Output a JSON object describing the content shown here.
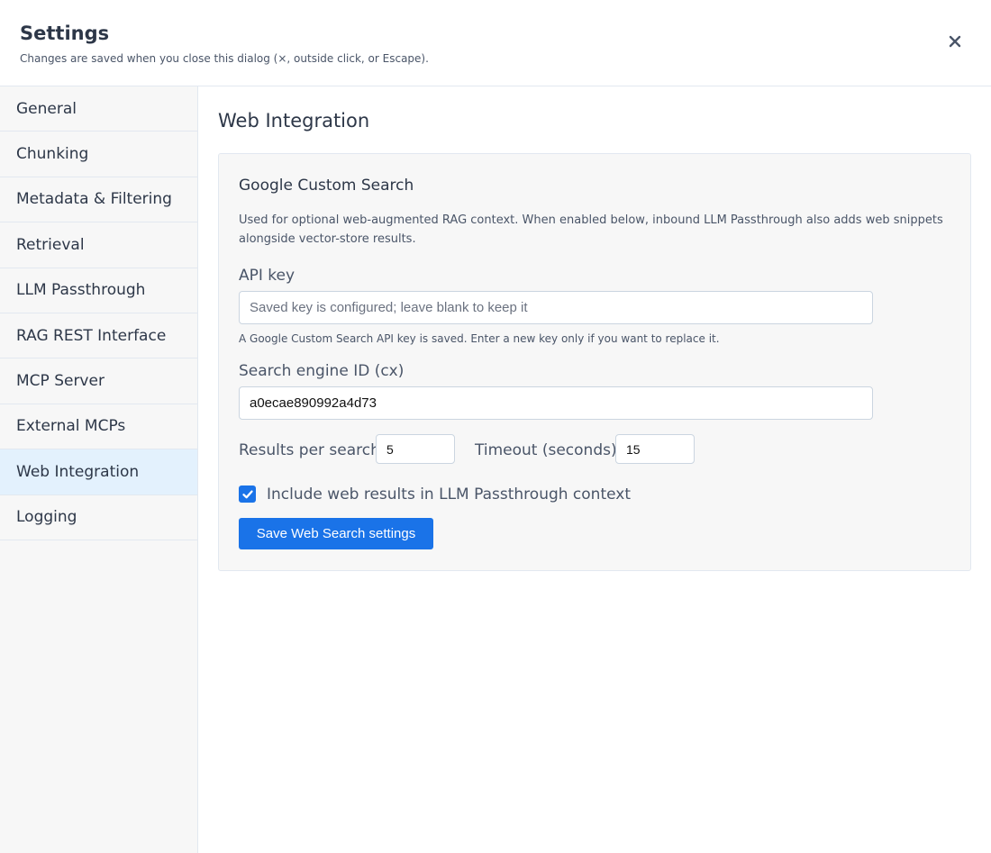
{
  "header": {
    "title": "Settings",
    "subtitle": "Changes are saved when you close this dialog (×, outside click, or Escape).",
    "close_icon": "close-icon"
  },
  "sidebar": {
    "items": [
      {
        "label": "General"
      },
      {
        "label": "Chunking"
      },
      {
        "label": "Metadata & Filtering"
      },
      {
        "label": "Retrieval"
      },
      {
        "label": "LLM Passthrough"
      },
      {
        "label": "RAG REST Interface"
      },
      {
        "label": "MCP Server"
      },
      {
        "label": "External MCPs"
      },
      {
        "label": "Web Integration",
        "active": true
      },
      {
        "label": "Logging"
      }
    ]
  },
  "main": {
    "section_title": "Web Integration",
    "card": {
      "title": "Google Custom Search",
      "description": "Used for optional web-augmented RAG context. When enabled below, inbound LLM Passthrough also adds web snippets alongside vector-store results.",
      "api_key": {
        "label": "API key",
        "value": "",
        "placeholder": "Saved key is configured; leave blank to keep it",
        "hint": "A Google Custom Search API key is saved. Enter a new key only if you want to replace it."
      },
      "engine_id": {
        "label": "Search engine ID (cx)",
        "value": "a0ecae890992a4d73"
      },
      "results_per_search": {
        "label": "Results per search",
        "value": "5"
      },
      "timeout": {
        "label": "Timeout (seconds)",
        "value": "15"
      },
      "include_web_results": {
        "label": "Include web results in LLM Passthrough context",
        "checked": true
      },
      "save_button_label": "Save Web Search settings"
    }
  },
  "colors": {
    "accent": "#1a73e8",
    "active_nav": "#e3f1fd",
    "sidebar_bg": "#f7f7f7",
    "text": "#2d3748"
  }
}
